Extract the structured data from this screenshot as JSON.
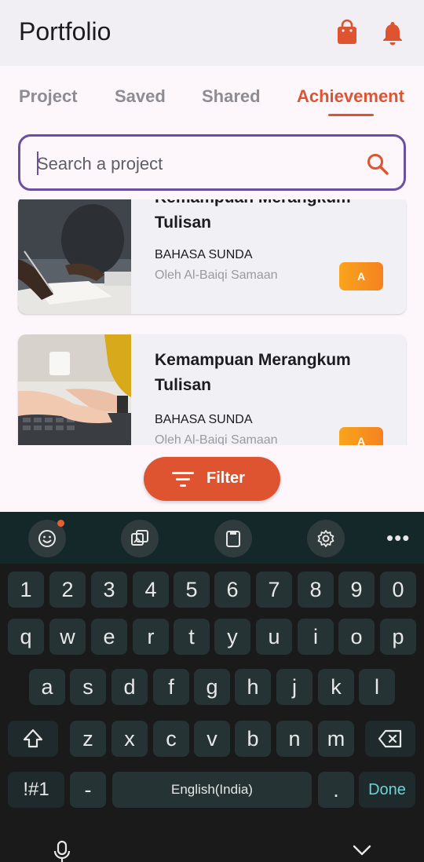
{
  "app": {
    "title": "Portfolio"
  },
  "tabs": [
    {
      "label": "Project",
      "active": false
    },
    {
      "label": "Saved",
      "active": false
    },
    {
      "label": "Shared",
      "active": false
    },
    {
      "label": "Achievement",
      "active": true
    }
  ],
  "search": {
    "placeholder": "Search a project"
  },
  "cards": [
    {
      "title_partial": "Kemampuan Merangkum",
      "title_line2": "Tulisan",
      "subject": "BAHASA SUNDA",
      "author": "Oleh Al-Baiqi Samaan",
      "grade": "A"
    },
    {
      "title": "Kemampuan Merangkum Tulisan",
      "subject": "BAHASA SUNDA",
      "author": "Oleh Al-Baiqi Samaan",
      "grade": "A"
    }
  ],
  "filter": {
    "label": "Filter"
  },
  "keyboard": {
    "toolbar": [
      "emoji-icon",
      "image-translate-icon",
      "clipboard-icon",
      "settings-icon",
      "more-icon"
    ],
    "more_label": "•••",
    "row_numbers": [
      "1",
      "2",
      "3",
      "4",
      "5",
      "6",
      "7",
      "8",
      "9",
      "0"
    ],
    "row_1": [
      "q",
      "w",
      "e",
      "r",
      "t",
      "y",
      "u",
      "i",
      "o",
      "p"
    ],
    "row_2": [
      "a",
      "s",
      "d",
      "f",
      "g",
      "h",
      "j",
      "k",
      "l"
    ],
    "row_3": [
      "z",
      "x",
      "c",
      "v",
      "b",
      "n",
      "m"
    ],
    "symbols_label": "!#1",
    "dash_label": "-",
    "space_label": "English(India)",
    "period_label": ".",
    "done_label": "Done"
  },
  "colors": {
    "accent": "#df5430",
    "focus": "#6b4fa0",
    "grade": "#f58220",
    "done": "#6ed3d6"
  }
}
